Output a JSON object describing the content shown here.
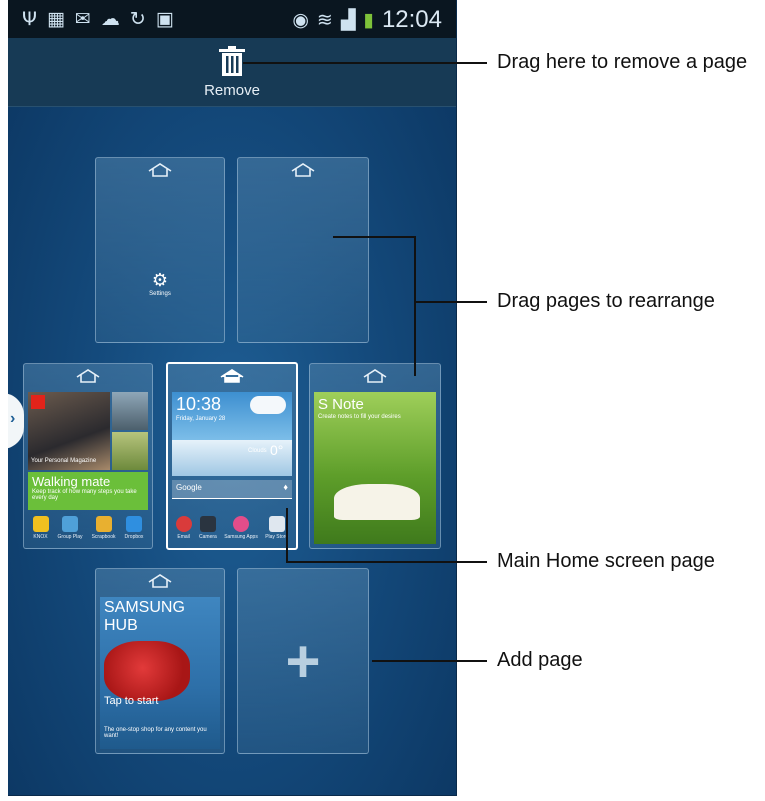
{
  "status_bar": {
    "time": "12:04"
  },
  "remove_bar": {
    "label": "Remove"
  },
  "pages": [
    {
      "name": "page-settings",
      "widget_label": "Settings"
    },
    {
      "name": "page-empty"
    },
    {
      "name": "page-magazine",
      "magazine_caption": "Your Personal Magazine",
      "walking_title": "Walking mate",
      "walking_text": "Keep track of how many steps you take every day",
      "apps": [
        "KNOX",
        "Group Play",
        "Scrapbook",
        "Dropbox"
      ]
    },
    {
      "name": "page-main-home",
      "time": "10:38",
      "date": "Friday, January 28",
      "weather": "Clouds",
      "temp": "0°",
      "search": "Google",
      "apps": [
        "Email",
        "Camera",
        "Samsung Apps",
        "Play Store"
      ]
    },
    {
      "name": "page-snote",
      "title": "S Note",
      "subtitle": "Create notes to fill your desires"
    },
    {
      "name": "page-samsung-hub",
      "title_line1": "SAMSUNG",
      "title_line2": "HUB",
      "cta": "Tap to start",
      "description": "The one-stop shop for any content you want!"
    },
    {
      "name": "page-add",
      "symbol": "+"
    }
  ],
  "callouts": {
    "remove": "Drag here to remove a page",
    "rearrange": "Drag pages to rearrange",
    "main": "Main Home screen page",
    "add": "Add page"
  },
  "colors": {
    "accent": "#1f5f95",
    "status_bar": "#0a1620",
    "remove_bar": "#173a55"
  }
}
